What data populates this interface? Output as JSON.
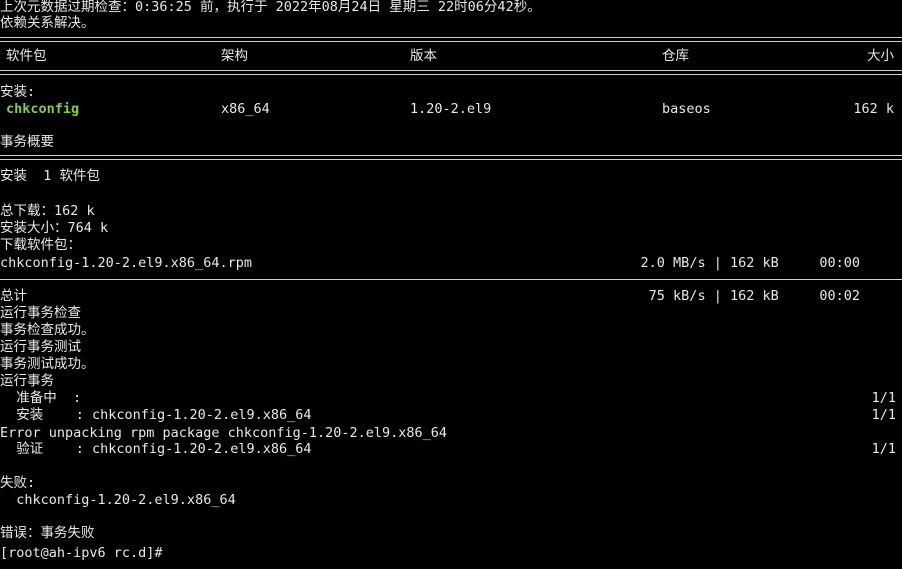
{
  "terminal": {
    "colors": {
      "background": "#000000",
      "text": "#e8e8e8",
      "package_highlight": "#7ecf4a"
    },
    "metadata_line": "上次元数据过期检查：0:36:25 前，执行于 2022年08月24日 星期三 22时06分42秒。",
    "deps_resolved": "依赖关系解决。",
    "table_headers": {
      "package": "软件包",
      "arch": "架构",
      "version": "版本",
      "repo": "仓库",
      "size": "大小"
    },
    "installing_label": "安装:",
    "package_row": {
      "name": "chkconfig",
      "arch": "x86_64",
      "version": "1.20-2.el9",
      "repo": "baseos",
      "size": "162 k"
    },
    "transaction_summary": "事务概要",
    "install_count": "安装  1 软件包",
    "total_download": "总下载：162 k",
    "installed_size": "安装大小：764 k",
    "downloading": "下载软件包：",
    "rpm_file": "chkconfig-1.20-2.el9.x86_64.rpm",
    "rpm_stats": "2.0 MB/s | 162 kB     00:00",
    "total_label": "总计",
    "total_stats": "75 kB/s | 162 kB     00:02",
    "steps": [
      "运行事务检查",
      "事务检查成功。",
      "运行事务测试",
      "事务测试成功。",
      "运行事务"
    ],
    "preparing": "  准备中  :",
    "preparing_count": "1/1",
    "installing_step": "  安装    : chkconfig-1.20-2.el9.x86_64",
    "installing_count": "1/1",
    "error_line": "Error unpacking rpm package chkconfig-1.20-2.el9.x86_64",
    "verifying_step": "  验证    : chkconfig-1.20-2.el9.x86_64",
    "verifying_count": "1/1",
    "failed_label": "失败:",
    "failed_pkg": "  chkconfig-1.20-2.el9.x86_64",
    "error_final": "错误：事务失败",
    "prompt": "[root@ah-ipv6 rc.d]#"
  }
}
